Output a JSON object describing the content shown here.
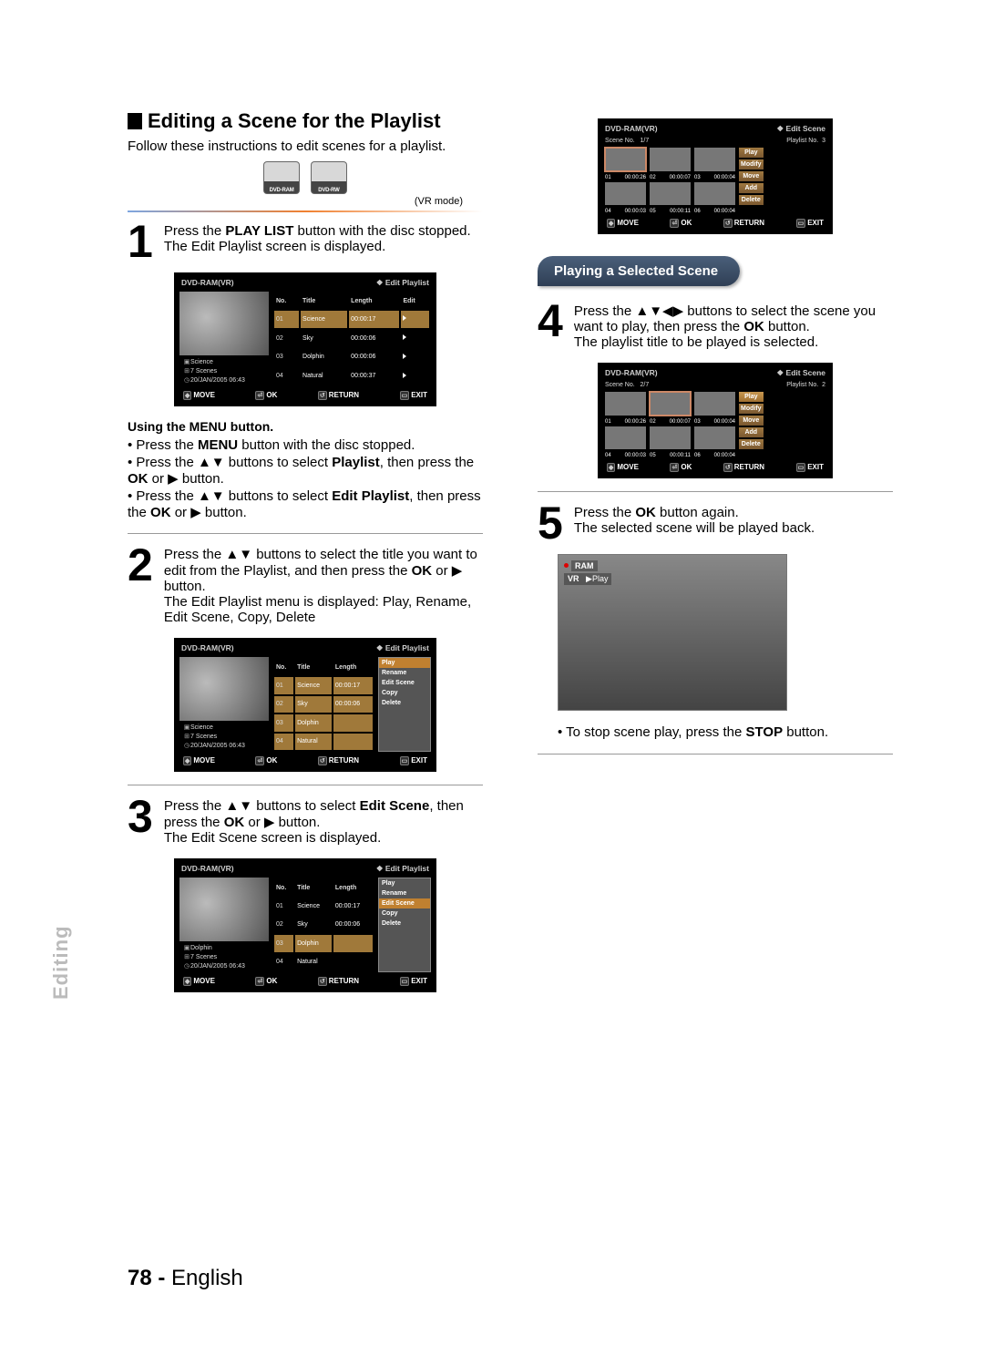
{
  "title": "Editing a Scene for the Playlist",
  "intro": "Follow these instructions to edit scenes for a playlist.",
  "disc_labels": {
    "ram": "DVD-RAM",
    "rw": "DVD-RW"
  },
  "vrmode": "(VR mode)",
  "step1": {
    "num": "1",
    "text_a": "Press the ",
    "bold_a": "PLAY LIST",
    "text_b": " button with the disc stopped. The Edit Playlist screen is displayed."
  },
  "ui1": {
    "header_left": "DVD-RAM(VR)",
    "header_right": "Edit Playlist",
    "cols": {
      "no": "No.",
      "title": "Title",
      "length": "Length",
      "edit": "Edit"
    },
    "rows": [
      {
        "no": "01",
        "title": "Science",
        "length": "00:00:17",
        "sel": true
      },
      {
        "no": "02",
        "title": "Sky",
        "length": "00:00:06"
      },
      {
        "no": "03",
        "title": "Dolphin",
        "length": "00:00:06"
      },
      {
        "no": "04",
        "title": "Natural",
        "length": "00:00:37"
      }
    ],
    "meta": {
      "title": "Science",
      "scenes": "7 Scenes",
      "date": "20/JAN/2005 06:43"
    },
    "footer": {
      "move": "MOVE",
      "ok": "OK",
      "ret": "RETURN",
      "exit": "EXIT"
    }
  },
  "menu": {
    "heading": "Using the MENU button.",
    "b1a": "Press the ",
    "b1b": "MENU",
    "b1c": " button with the disc stopped.",
    "b2a": "Press the ▲▼ buttons to select ",
    "b2b": "Playlist",
    "b2c": ", then press the ",
    "b2d": "OK",
    "b2e": " or ▶ button.",
    "b3a": "Press the ▲▼ buttons to select ",
    "b3b": "Edit Playlist",
    "b3c": ", then press the ",
    "b3d": "OK",
    "b3e": " or ▶ button."
  },
  "step2": {
    "num": "2",
    "t1": "Press the ▲▼ buttons to select the title you want to edit from the Playlist, and then press the ",
    "b1": "OK",
    "t2": " or ▶ button.",
    "t3": "The Edit Playlist menu is displayed: Play, Rename, Edit Scene, Copy, Delete"
  },
  "ui2": {
    "submenu": [
      "Play",
      "Rename",
      "Edit Scene",
      "Copy",
      "Delete"
    ]
  },
  "step3": {
    "num": "3",
    "t1": "Press the ▲▼ buttons to select ",
    "b1": "Edit Scene",
    "t2": ", then press the ",
    "b2": "OK",
    "t3": " or ▶ button.",
    "t4": "The Edit Scene screen is displayed."
  },
  "ui3": {
    "meta": {
      "title": "Dolphin",
      "scenes": "7 Scenes",
      "date": "20/JAN/2005 06:43"
    },
    "sel_row": 2
  },
  "ui_scene": {
    "header_left": "DVD-RAM(VR)",
    "header_right": "Edit Scene",
    "sceneno_label": "Scene No.",
    "playlist_label": "Playlist No.",
    "btns": [
      "Play",
      "Modify",
      "Move",
      "Add",
      "Delete"
    ],
    "a": {
      "count": "1/7",
      "plno": "3",
      "cells": [
        {
          "n": "01",
          "t": "00:00:26",
          "sel": true
        },
        {
          "n": "02",
          "t": "00:00:07"
        },
        {
          "n": "03",
          "t": "00:00:04"
        },
        {
          "n": "04",
          "t": "00:00:03"
        },
        {
          "n": "05",
          "t": "00:00:11"
        },
        {
          "n": "06",
          "t": "00:00:04"
        }
      ]
    },
    "b": {
      "count": "2/7",
      "plno": "2",
      "cells": [
        {
          "n": "01",
          "t": "00:00:26"
        },
        {
          "n": "02",
          "t": "00:00:07",
          "sel": true
        },
        {
          "n": "03",
          "t": "00:00:04"
        },
        {
          "n": "04",
          "t": "00:00:03"
        },
        {
          "n": "05",
          "t": "00:00:11"
        },
        {
          "n": "06",
          "t": "00:00:04"
        }
      ]
    }
  },
  "pill": "Playing a Selected Scene",
  "step4": {
    "num": "4",
    "t1": "Press the ▲▼◀▶ buttons to select the scene you want to play, then press the ",
    "b1": "OK",
    "t2": " button.",
    "t3": "The playlist title to be played is selected."
  },
  "step5": {
    "num": "5",
    "t1": "Press the ",
    "b1": "OK",
    "t2": " button again.",
    "t3": "The selected scene will be played back."
  },
  "preview": {
    "tag1": "RAM",
    "tag2": "VR",
    "play": "▶Play"
  },
  "stopline": {
    "a": "To stop scene play, press the ",
    "b": "STOP",
    "c": " button."
  },
  "sidebar": "Editing",
  "pgnum": "78 -",
  "pglang": "English"
}
